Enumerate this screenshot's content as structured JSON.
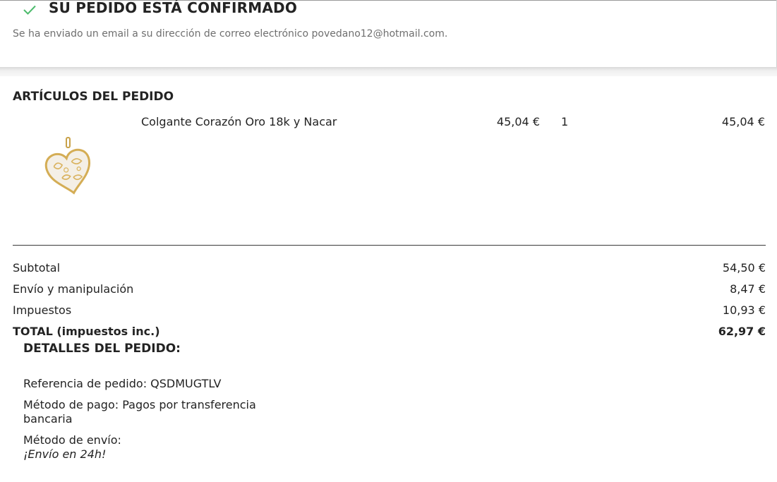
{
  "confirmation": {
    "title": "SU PEDIDO ESTÁ CONFIRMADO",
    "message": "Se ha enviado un email a su dirección de correo electrónico povedano12@hotmail.com.",
    "check_color": "#4cbb6c"
  },
  "items_section": {
    "title": "ARTÍCULOS DEL PEDIDO",
    "items": [
      {
        "name": "Colgante Corazón Oro 18k y Nacar",
        "unit_price": "45,04 €",
        "quantity": "1",
        "total": "45,04 €",
        "image": "gold-heart-pendant-image"
      }
    ]
  },
  "totals": {
    "subtotal_label": "Subtotal",
    "subtotal_value": "54,50 €",
    "shipping_label": "Envío y manipulación",
    "shipping_value": "8,47 €",
    "taxes_label": "Impuestos",
    "taxes_value": "10,93 €",
    "grand_label": "TOTAL (impuestos inc.)",
    "grand_value": "62,97 €"
  },
  "details": {
    "title": "DETALLES DEL PEDIDO:",
    "reference": "Referencia de pedido: QSDMUGTLV",
    "payment": "Método de pago: Pagos por transferencia bancaria",
    "shipping_method_label": "Método de envío:",
    "shipping_method_value": "¡Envío en 24h!"
  }
}
